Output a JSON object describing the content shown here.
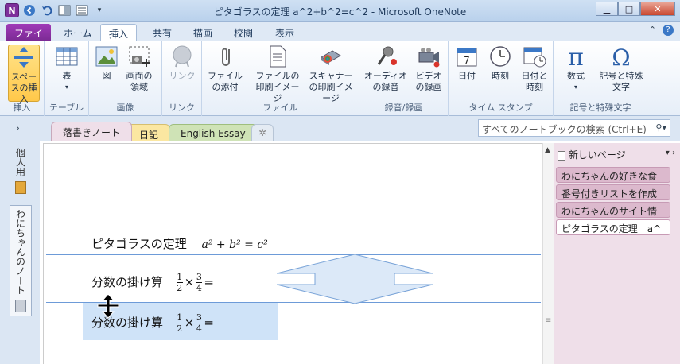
{
  "window": {
    "title": "ピタゴラスの定理  a^2+b^2=c^2 - Microsoft OneNote",
    "controls": [
      "minimize",
      "maximize",
      "close"
    ]
  },
  "qat": {
    "app_icon": "N"
  },
  "ribbon_tabs": [
    "ファイル",
    "ホーム",
    "挿入",
    "共有",
    "描画",
    "校閲",
    "表示"
  ],
  "active_tab": "挿入",
  "ribbon": {
    "groups": {
      "insert": {
        "label": "挿入",
        "buttons": [
          "スペースの挿入"
        ]
      },
      "table": {
        "label": "テーブル",
        "buttons": [
          "表"
        ]
      },
      "images": {
        "label": "画像",
        "buttons": [
          "図",
          "画面の領域"
        ]
      },
      "link": {
        "label": "リンク",
        "buttons": [
          "リンク"
        ]
      },
      "file": {
        "label": "ファイル",
        "buttons": [
          "ファイルの添付",
          "ファイルの印刷イメージ",
          "スキャナーの印刷イメージ"
        ]
      },
      "recording": {
        "label": "録音/録画",
        "buttons": [
          "オーディオの録音",
          "ビデオの録画"
        ]
      },
      "timestamp": {
        "label": "タイム スタンプ",
        "buttons": [
          "日付",
          "時刻",
          "日付と時刻"
        ]
      },
      "symbols": {
        "label": "記号と特殊文字",
        "buttons": [
          "数式",
          "記号と特殊文字"
        ]
      }
    }
  },
  "section_tabs": [
    "落書きノート",
    "日記",
    "English Essay"
  ],
  "search": {
    "placeholder": "すべてのノートブックの検索 (Ctrl+E)"
  },
  "notebooks": [
    "個人用",
    "わにちゃんのノート"
  ],
  "page": {
    "line1": {
      "text": "ピタゴラスの定理",
      "math": "a² + b² = c²"
    },
    "line2": {
      "text": "分数の掛け算",
      "num1": "1",
      "den1": "2",
      "op": "×",
      "num2": "3",
      "den2": "4",
      "eq": "="
    },
    "line3": {
      "text": "分数の掛け算",
      "num1": "1",
      "den1": "2",
      "op": "×",
      "num2": "3",
      "den2": "4",
      "eq": "="
    }
  },
  "pagelist": {
    "new_page": "新しいページ",
    "items": [
      "わにちゃんの好きな食",
      "番号付きリストを作成",
      "わにちゃんのサイト情",
      "ピタゴラスの定理　a^"
    ]
  },
  "colors": {
    "file_tab": "#7a2a93",
    "page_list_bg": "#efdfe9",
    "divider": "#6d9bd8",
    "selection": "#cfe3f8"
  }
}
